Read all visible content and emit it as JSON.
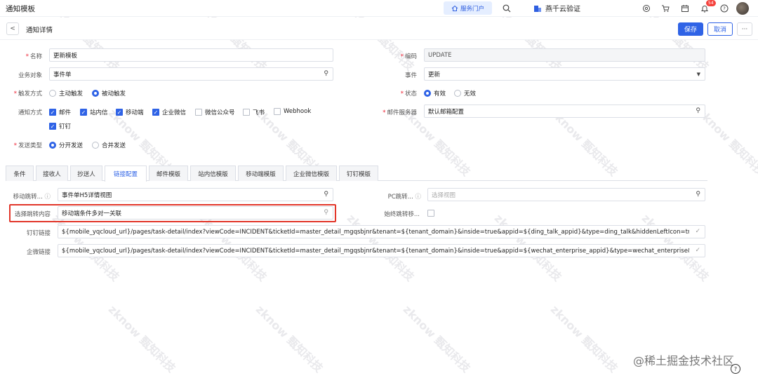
{
  "topbar": {
    "app_title": "通知模板",
    "portal_label": "服务门户",
    "tenant_name": "燕千云验证",
    "notification_count": "54"
  },
  "subbar": {
    "title": "通知详情",
    "save_label": "保存",
    "cancel_label": "取消",
    "more_label": "···"
  },
  "form": {
    "name_label": "名称",
    "name_value": "更新模板",
    "code_label": "编码",
    "code_value": "UPDATE",
    "business_object_label": "业务对象",
    "business_object_value": "事件单",
    "event_label": "事件",
    "event_value": "更新",
    "trigger_label": "触发方式",
    "trigger_options": [
      "主动触发",
      "被动触发"
    ],
    "trigger_selected": 1,
    "status_label": "状态",
    "status_options": [
      "有效",
      "无效"
    ],
    "status_selected": 0,
    "notify_label": "通知方式",
    "notify_options": [
      {
        "label": "邮件",
        "checked": true
      },
      {
        "label": "站内信",
        "checked": true
      },
      {
        "label": "移动端",
        "checked": true
      },
      {
        "label": "企业微信",
        "checked": true
      },
      {
        "label": "微信公众号",
        "checked": false
      },
      {
        "label": "飞书",
        "checked": false
      },
      {
        "label": "Webhook",
        "checked": false
      },
      {
        "label": "钉钉",
        "checked": true
      }
    ],
    "mail_server_label": "邮件服务器",
    "mail_server_value": "默认邮箱配置",
    "send_type_label": "发送类型",
    "send_type_options": [
      "分开发送",
      "合并发送"
    ],
    "send_type_selected": 0
  },
  "tabs": [
    "条件",
    "接收人",
    "抄送人",
    "链接配置",
    "邮件模版",
    "站内信模版",
    "移动端模版",
    "企业微信模版",
    "钉钉模版"
  ],
  "active_tab": 3,
  "link_config": {
    "mobile_jump_label": "移动跳转...",
    "mobile_jump_value": "事件单H5详情视图",
    "pc_jump_label": "PC跳转...",
    "pc_jump_placeholder": "选择视图",
    "select_content_label": "选择跳转内容",
    "select_content_value": "移动端条件多对一关联",
    "always_jump_label": "始终跳转移...",
    "dingtalk_link_label": "钉钉链接",
    "dingtalk_link_value": "${mobile_yqcloud_url}/pages/task-detail/index?viewCode=INCIDENT&ticketId=master_detail_mgqsbjnr&tenant=${tenant_domain}&inside=true&appid=${ding_talk_appid}&type=ding_talk&hiddenLeftIcon=true",
    "wecom_link_label": "企微链接",
    "wecom_link_value": "${mobile_yqcloud_url}/pages/task-detail/index?viewCode=INCIDENT&ticketId=master_detail_mgqsbjnr&tenant=${tenant_domain}&inside=true&appid=${wechat_enterprise_appid}&type=wechat_enterprise&hid"
  },
  "footer_watermark": "@稀土掘金技术社区",
  "watermark_text": "zknow 甄知科技",
  "colors": {
    "accent": "#2f63e6",
    "highlight": "#e2362a"
  }
}
